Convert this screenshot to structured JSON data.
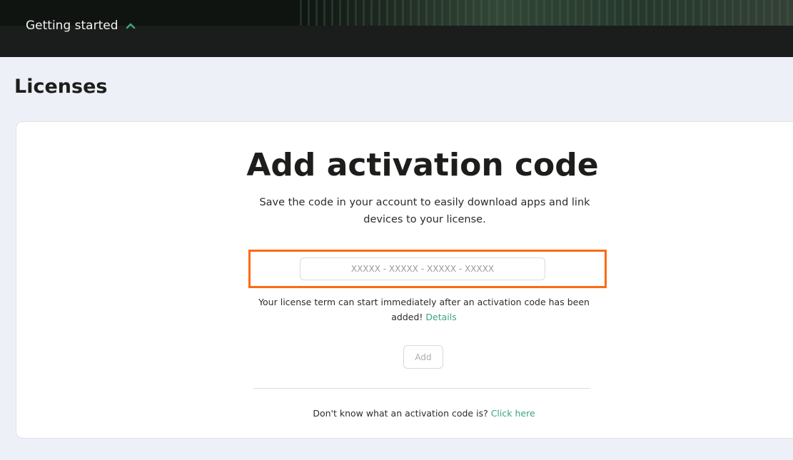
{
  "header": {
    "getting_started_label": "Getting started",
    "chevron_icon": "chevron-up-icon",
    "colors": {
      "background": "#0f1411",
      "chevron": "#3aa57a"
    }
  },
  "page": {
    "title": "Licenses"
  },
  "activation": {
    "heading": "Add activation code",
    "description": "Save the code in your account to easily download apps and link devices to your license.",
    "input_placeholder": "XXXXX - XXXXX - XXXXX - XXXXX",
    "input_value": "",
    "term_note": "Your license term can start immediately after an activation code has been added!",
    "details_link": "Details",
    "add_button": "Add",
    "help_text": "Don't know what an activation code is?",
    "help_link": "Click here",
    "colors": {
      "link": "#3aa57a",
      "highlight": "#ff6a13"
    }
  }
}
